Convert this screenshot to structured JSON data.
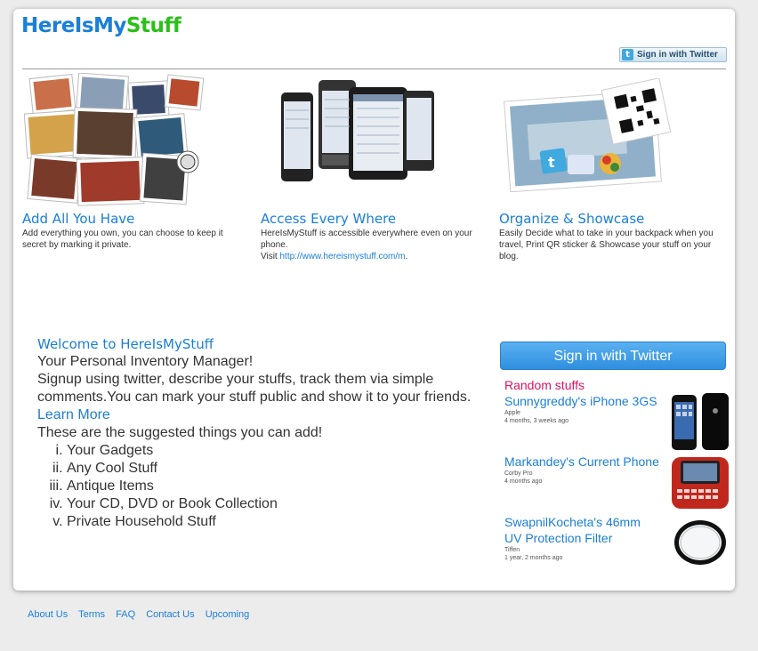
{
  "header": {
    "logo_part1": "HereIsMy",
    "logo_part2": "Stuff",
    "signin_small": "Sign in with Twitter"
  },
  "features": [
    {
      "title": "Add All You Have",
      "desc": "Add everything you own, you can choose to keep it secret by marking it private."
    },
    {
      "title": "Access Every Where",
      "desc": "HereIsMyStuff is accessible everywhere even on your phone.",
      "visit_label": "Visit",
      "link": "http://www.hereismystuff.com/m",
      "link_suffix": "."
    },
    {
      "title": "Organize & Showcase",
      "desc": "Easily Decide what to take in your backpack when you travel, Print QR sticker & Showcase your stuff on your blog."
    }
  ],
  "welcome": {
    "title": "Welcome to HereIsMyStuff",
    "line1": "Your Personal Inventory Manager!",
    "line2": "Signup using twitter, describe your stuffs, track them via simple comments.You can mark your stuff public and show it to your friends.",
    "learn_more": "Learn More",
    "line3": "These are the suggested things you can add!",
    "items": [
      "Your Gadgets",
      "Any Cool Stuff",
      "Antique Items",
      "Your CD, DVD or Book Collection",
      "Private Household Stuff"
    ]
  },
  "sidebar": {
    "signin_big": "Sign in with Twitter",
    "random_label": "Random stuffs",
    "stuffs": [
      {
        "title": "Sunnygreddy's iPhone 3GS",
        "sub": "Apple",
        "age": "4 months, 3 weeks ago"
      },
      {
        "title": "Markandey's Current Phone",
        "sub": "Corby Pro",
        "age": "4 months ago"
      },
      {
        "title": "SwapnilKocheta's 46mm UV Protection Filter",
        "sub": "Tiffen",
        "age": "1 year, 2 months ago"
      }
    ]
  },
  "footer": {
    "links": [
      "About Us",
      "Terms",
      "FAQ",
      "Contact Us",
      "Upcoming"
    ]
  },
  "colors": {
    "accent": "#1a7fd6",
    "logo_green": "#2bbf1a",
    "random": "#e0115f",
    "background": "#ececec"
  }
}
